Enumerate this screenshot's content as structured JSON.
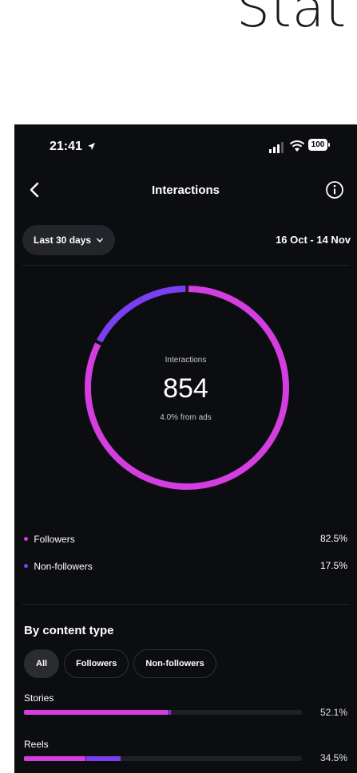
{
  "page_heading_fragment": "Stat",
  "status_bar": {
    "time": "21:41",
    "battery": "100"
  },
  "nav": {
    "title": "Interactions"
  },
  "filter": {
    "range_label": "Last 30 days",
    "date_range": "16 Oct - 14 Nov"
  },
  "summary": {
    "label": "Interactions",
    "value": "854",
    "sub": "4.0% from ads",
    "followers_fraction": 0.825,
    "non_followers_fraction": 0.175
  },
  "legend": [
    {
      "label": "Followers",
      "value": "82.5%",
      "color": "#d43ee0"
    },
    {
      "label": "Non-followers",
      "value": "17.5%",
      "color": "#7b3ff2"
    }
  ],
  "content_type": {
    "title": "By content type",
    "chips": [
      {
        "label": "All",
        "active": true
      },
      {
        "label": "Followers",
        "active": false
      },
      {
        "label": "Non-followers",
        "active": false
      }
    ],
    "rows": [
      {
        "label": "Stories",
        "value": "52.1%",
        "followers_fraction": 0.521,
        "non_followers_fraction": 0.004
      },
      {
        "label": "Reels",
        "value": "34.5%",
        "followers_fraction": 0.22,
        "non_followers_fraction": 0.125
      }
    ]
  },
  "colors": {
    "followers": "#d43ee0",
    "non_followers": "#7b3ff2",
    "background": "#0c0d10"
  },
  "icons": [
    "location-arrow-icon",
    "signal-icon",
    "wifi-icon",
    "battery-icon",
    "back-chevron-icon",
    "info-icon",
    "chevron-down-icon"
  ]
}
